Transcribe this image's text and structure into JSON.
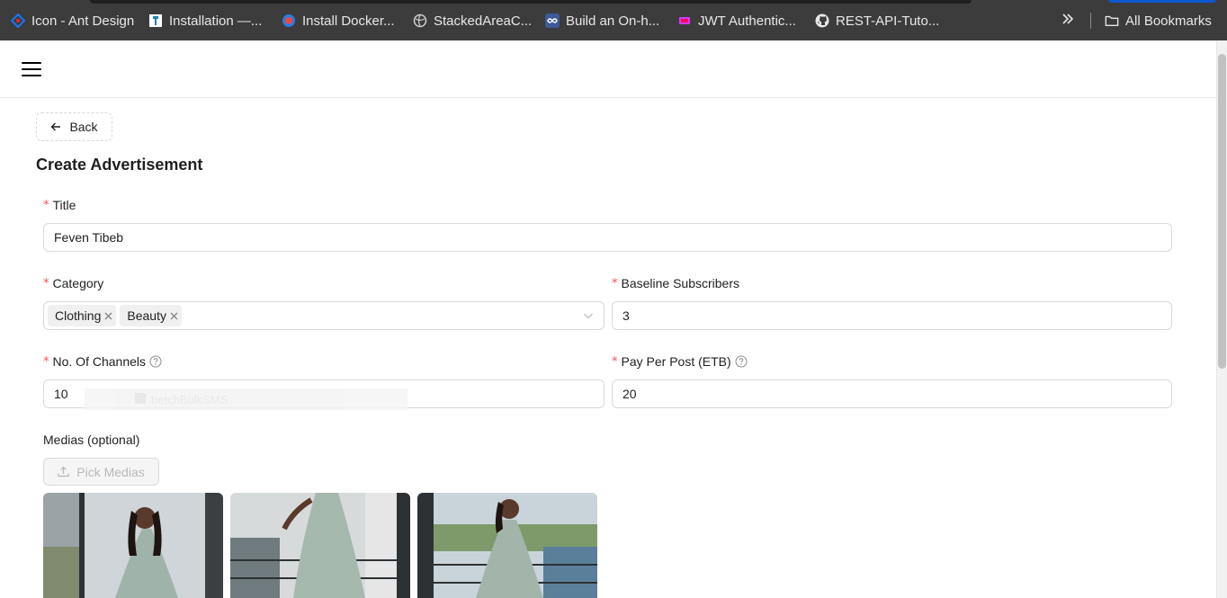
{
  "bookmarks": [
    {
      "label": "Icon - Ant Design",
      "icon": "ant-design-icon"
    },
    {
      "label": "Installation —...",
      "icon": "docs-icon"
    },
    {
      "label": "Install Docker...",
      "icon": "docker-icon"
    },
    {
      "label": "StackedAreaC...",
      "icon": "globe-icon"
    },
    {
      "label": "Build an On-h...",
      "icon": "infinity-icon"
    },
    {
      "label": "JWT Authentic...",
      "icon": "jwt-icon"
    },
    {
      "label": "REST-API-Tuto...",
      "icon": "github-icon"
    }
  ],
  "bookmarks_more_icon": "double-chevron-right-icon",
  "all_bookmarks": {
    "label": "All Bookmarks",
    "icon": "folder-icon"
  },
  "header": {
    "menu_icon": "hamburger-menu-icon"
  },
  "back_button": {
    "label": "Back",
    "icon": "arrow-left-icon"
  },
  "page_title": "Create Advertisement",
  "form": {
    "title": {
      "label": "Title",
      "required_mark": "*",
      "value": "Feven Tibeb"
    },
    "category": {
      "label": "Category",
      "required_mark": "*",
      "tags": [
        "Clothing",
        "Beauty"
      ]
    },
    "baseline_subscribers": {
      "label": "Baseline Subscribers",
      "required_mark": "*",
      "value": "3"
    },
    "channels": {
      "label": "No. Of Channels",
      "required_mark": "*",
      "value": "10",
      "help_icon": "question-circle-icon"
    },
    "pay_per_post": {
      "label": "Pay Per Post (ETB)",
      "required_mark": "*",
      "value": "20",
      "help_icon": "question-circle-icon"
    },
    "medias": {
      "label": "Medias (optional)",
      "button_label": "Pick Medias",
      "button_icon": "upload-icon"
    }
  },
  "autofill_suggestion": "betchBulkSMS",
  "colors": {
    "required": "#ff4d4f",
    "bookmark_bar": "#3c3c3c",
    "border": "#d9d9d9"
  }
}
